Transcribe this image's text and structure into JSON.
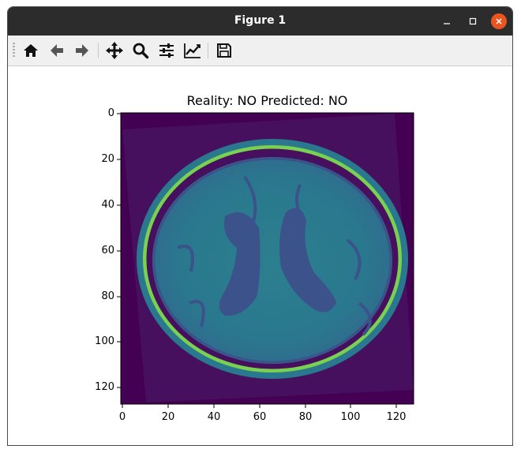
{
  "window": {
    "title": "Figure 1"
  },
  "toolbar": {
    "buttons": [
      {
        "name": "home",
        "icon": "home-icon"
      },
      {
        "name": "back",
        "icon": "arrow-left-icon"
      },
      {
        "name": "forward",
        "icon": "arrow-right-icon"
      },
      {
        "name": "pan",
        "icon": "move-icon"
      },
      {
        "name": "zoom",
        "icon": "magnifier-icon"
      },
      {
        "name": "subplots",
        "icon": "sliders-icon"
      },
      {
        "name": "edit-axes",
        "icon": "line-chart-icon"
      },
      {
        "name": "save",
        "icon": "floppy-disk-icon"
      }
    ]
  },
  "plot": {
    "title": "Reality: NO Predicted: NO",
    "x_ticks": [
      "0",
      "20",
      "40",
      "60",
      "80",
      "100",
      "120"
    ],
    "y_ticks": [
      "0",
      "20",
      "40",
      "60",
      "80",
      "100",
      "120"
    ],
    "image_extent": [
      128,
      128
    ],
    "colormap": "viridis",
    "colors": {
      "background": "#440154",
      "tissue": "#2a788e",
      "ventricles": "#3b528b",
      "skull": "#7ad151"
    }
  }
}
